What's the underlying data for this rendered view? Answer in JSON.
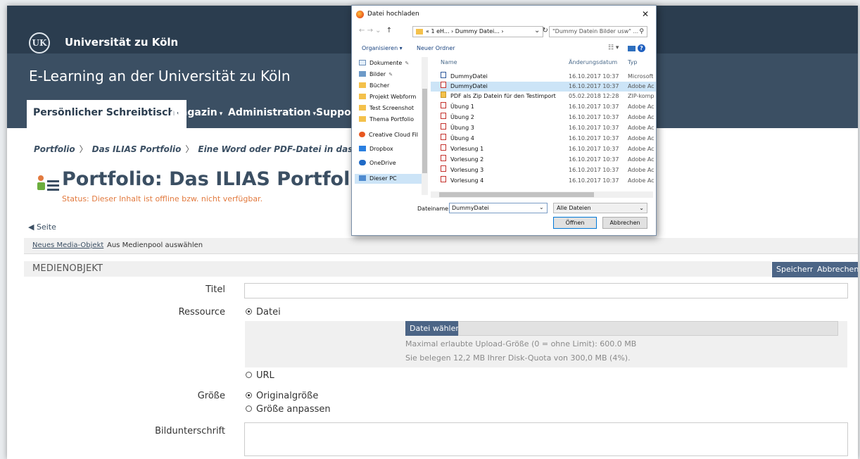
{
  "header": {
    "university": "Universität zu Köln",
    "site_title": "E-Learning an der Universität zu Köln",
    "logo_icon": "university-seal-icon"
  },
  "nav": {
    "items": [
      {
        "label": "Persönlicher Schreibtisch",
        "active": true
      },
      {
        "label": "Magazin",
        "active": false
      },
      {
        "label": "Administration",
        "active": false
      },
      {
        "label": "Support",
        "active": false
      }
    ]
  },
  "breadcrumb": {
    "items": [
      "Portfolio",
      "Das ILIAS Portfolio",
      "Eine Word oder PDF-Datei in das Portfolio einfüg"
    ]
  },
  "page": {
    "title": "Portfolio: Das ILIAS Portfolio",
    "status": "Status: Dieser Inhalt ist offline bzw. nicht verfügbar.",
    "back_link": "Seite",
    "title_icon": "portfolio-icon"
  },
  "subtabs": {
    "new_media": "Neues Media-Objekt",
    "from_pool": "Aus Medienpool auswählen"
  },
  "form": {
    "header": "MEDIENOBJEKT",
    "save": "Speichern",
    "cancel": "Abbrechen",
    "title_label": "Titel",
    "title_value": "",
    "resource_label": "Ressource",
    "resource_file": "Datei",
    "choose_file": "Datei wählen",
    "max_upload": "Maximal erlaubte Upload-Größe (0 = ohne Limit): 600.0 MB",
    "quota": "Sie belegen 12,2 MB Ihrer Disk-Quota von 300,0 MB (4%).",
    "resource_url": "URL",
    "size_label": "Größe",
    "size_original": "Originalgröße",
    "size_adjust": "Größe anpassen",
    "caption_label": "Bildunterschrift",
    "caption_value": ""
  },
  "dialog": {
    "title": "Datei hochladen",
    "close": "✕",
    "path": "« 1 eH... › Dummy Datei... ›",
    "search_placeholder": "\"Dummy Datein Bilder usw\" ...",
    "organize": "Organisieren ▾",
    "new_folder": "Neuer Ordner",
    "sidebar": [
      {
        "label": "Dokumente",
        "icon": "document-icon",
        "pinned": true
      },
      {
        "label": "Bilder",
        "icon": "pictures-icon",
        "pinned": true
      },
      {
        "label": "Bücher",
        "icon": "folder-icon",
        "pinned": false
      },
      {
        "label": "Projekt Webform",
        "icon": "folder-icon",
        "pinned": false
      },
      {
        "label": "Test Screenshot",
        "icon": "folder-icon",
        "pinned": false
      },
      {
        "label": "Thema Portfolio",
        "icon": "folder-icon",
        "pinned": false
      },
      {
        "label": "Creative Cloud Fil",
        "icon": "creative-cloud-icon",
        "pinned": false
      },
      {
        "label": "Dropbox",
        "icon": "dropbox-icon",
        "pinned": false
      },
      {
        "label": "OneDrive",
        "icon": "onedrive-icon",
        "pinned": false
      },
      {
        "label": "Dieser PC",
        "icon": "computer-icon",
        "pinned": false
      }
    ],
    "columns": {
      "name": "Name",
      "date": "Änderungsdatum",
      "type": "Typ"
    },
    "files": [
      {
        "name": "DummyDatei",
        "date": "16.10.2017 10:37",
        "type": "Microsoft",
        "icon": "word-file-icon"
      },
      {
        "name": "DummyDatei",
        "date": "16.10.2017 10:37",
        "type": "Adobe Ac",
        "icon": "pdf-file-icon"
      },
      {
        "name": "PDF als Zip  Datein für den Testimport",
        "date": "05.02.2018 12:28",
        "type": "ZIP-komp",
        "icon": "zip-file-icon"
      },
      {
        "name": "Übung 1",
        "date": "16.10.2017 10:37",
        "type": "Adobe Ac",
        "icon": "pdf-file-icon"
      },
      {
        "name": "Übung 2",
        "date": "16.10.2017 10:37",
        "type": "Adobe Ac",
        "icon": "pdf-file-icon"
      },
      {
        "name": "Übung 3",
        "date": "16.10.2017 10:37",
        "type": "Adobe Ac",
        "icon": "pdf-file-icon"
      },
      {
        "name": "Übung 4",
        "date": "16.10.2017 10:37",
        "type": "Adobe Ac",
        "icon": "pdf-file-icon"
      },
      {
        "name": "Vorlesung 1",
        "date": "16.10.2017 10:37",
        "type": "Adobe Ac",
        "icon": "pdf-file-icon"
      },
      {
        "name": "Vorlesung 2",
        "date": "16.10.2017 10:37",
        "type": "Adobe Ac",
        "icon": "pdf-file-icon"
      },
      {
        "name": "Vorlesung 3",
        "date": "16.10.2017 10:37",
        "type": "Adobe Ac",
        "icon": "pdf-file-icon"
      },
      {
        "name": "Vorlesung 4",
        "date": "16.10.2017 10:37",
        "type": "Adobe Ac",
        "icon": "pdf-file-icon"
      }
    ],
    "filename_label": "Dateiname:",
    "filename_value": "DummyDatei",
    "filter": "Alle Dateien",
    "open": "Öffnen",
    "cancel": "Abbrechen"
  },
  "colors": {
    "header_dark": "#2b3d4f",
    "header": "#3b4f63",
    "status_orange": "#e27a3f",
    "button": "#4c6586",
    "selection": "#cce4f7"
  }
}
